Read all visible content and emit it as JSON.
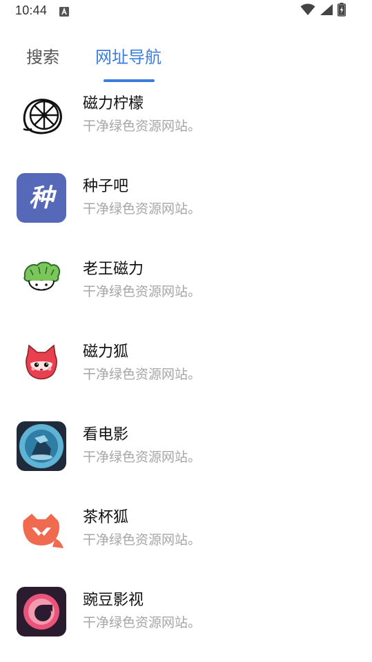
{
  "status_bar": {
    "time": "10:44",
    "icons": [
      "a-notification-icon",
      "wifi-icon",
      "signal-icon",
      "battery-charging-icon"
    ]
  },
  "tabs": [
    {
      "label": "搜索",
      "active": false
    },
    {
      "label": "网址导航",
      "active": true
    }
  ],
  "colors": {
    "accent": "#3b7ddd",
    "secondary_text": "#a6a6a6"
  },
  "items": [
    {
      "title": "磁力柠檬",
      "desc": "干净绿色资源网站。",
      "icon": "lemon-logo-icon"
    },
    {
      "title": "种子吧",
      "desc": "干净绿色资源网站。",
      "icon": "zhong-logo-icon",
      "icon_text": "种"
    },
    {
      "title": "老王磁力",
      "desc": "干净绿色资源网站。",
      "icon": "cabbage-face-logo-icon"
    },
    {
      "title": "磁力狐",
      "desc": "干净绿色资源网站。",
      "icon": "fox-logo-icon"
    },
    {
      "title": "看电影",
      "desc": "干净绿色资源网站。",
      "icon": "movie-logo-icon"
    },
    {
      "title": "茶杯狐",
      "desc": "干净绿色资源网站。",
      "icon": "teacup-fox-logo-icon"
    },
    {
      "title": "豌豆影视",
      "desc": "干净绿色资源网站。",
      "icon": "pea-video-logo-icon"
    }
  ]
}
